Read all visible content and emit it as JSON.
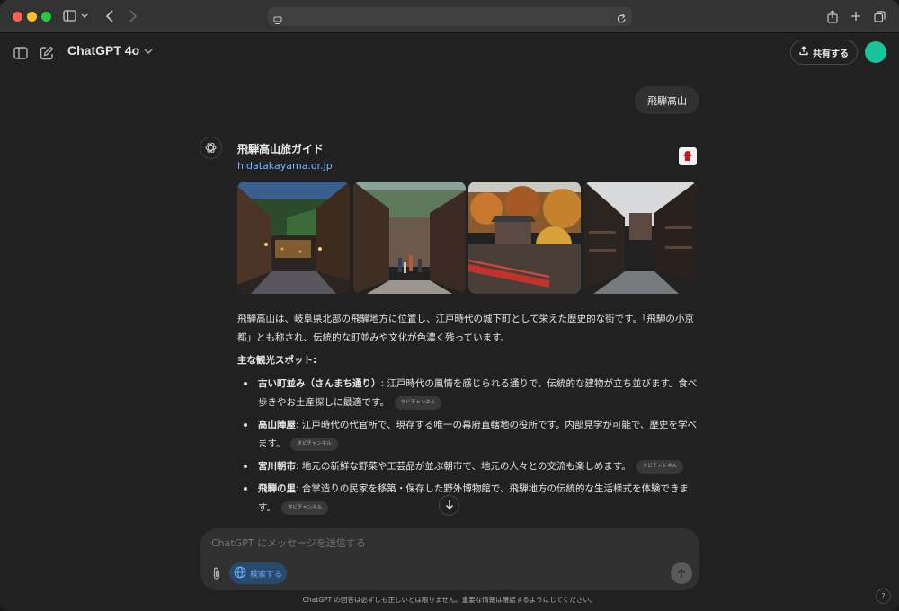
{
  "browser": {
    "url_text": ""
  },
  "header": {
    "model_name": "ChatGPT 4o",
    "share_label": "共有する"
  },
  "conversation": {
    "user_message": "飛騨高山",
    "source": {
      "title": "飛騨高山旅ガイド",
      "url": "hidatakayama.or.jp"
    },
    "intro": "飛騨高山は、岐阜県北部の飛騨地方に位置し、江戸時代の城下町として栄えた歴史的な街です。「飛騨の小京都」とも称され、伝統的な町並みや文化が色濃く残っています。",
    "spots_heading": "主な観光スポット:",
    "spots": [
      {
        "name": "古い町並み（さんまち通り）",
        "desc": ": 江戸時代の風情を感じられる通りで、伝統的な建物が立ち並びます。食べ歩きやお土産探しに最適です。",
        "chip": "タビチャンネル"
      },
      {
        "name": "高山陣屋",
        "desc": ": 江戸時代の代官所で、現存する唯一の幕府直轄地の役所です。内部見学が可能で、歴史を学べます。",
        "chip": "タビチャンネル"
      },
      {
        "name": "宮川朝市",
        "desc": ": 地元の新鮮な野菜や工芸品が並ぶ朝市で、地元の人々との交流も楽しめます。",
        "chip": "タビチャンネル"
      },
      {
        "name": "飛騨の里",
        "desc": ": 合掌造りの民家を移築・保存した野外博物館で、飛騨地方の伝統的な生活様式を体験できます。",
        "chip": "タビチャンネル"
      }
    ]
  },
  "composer": {
    "placeholder": "ChatGPT にメッセージを送信する",
    "search_label": "検索する"
  },
  "footer": {
    "disclaimer": "ChatGPT の回答は必ずしも正しいとは限りません。重要な情報は確認するようにしてください。",
    "help_label": "?"
  },
  "colors": {
    "accent_avatar": "#19c39c",
    "link": "#7ab7ff",
    "search_active": "#6aa9ff"
  }
}
